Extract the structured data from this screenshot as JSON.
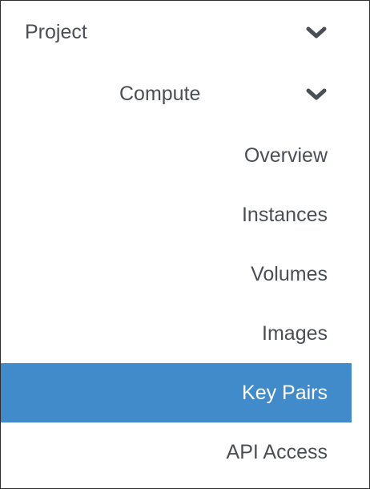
{
  "sidebar": {
    "project": {
      "label": "Project",
      "icon": "chevron-down-icon"
    },
    "compute": {
      "label": "Compute",
      "icon": "chevron-down-icon"
    },
    "items": [
      {
        "label": "Overview",
        "active": false
      },
      {
        "label": "Instances",
        "active": false
      },
      {
        "label": "Volumes",
        "active": false
      },
      {
        "label": "Images",
        "active": false
      },
      {
        "label": "Key Pairs",
        "active": true
      },
      {
        "label": "API Access",
        "active": false
      }
    ]
  },
  "colors": {
    "active_background": "#428bca",
    "active_text": "#ffffff",
    "text": "#4a4f55",
    "border": "#2e2e2e"
  }
}
